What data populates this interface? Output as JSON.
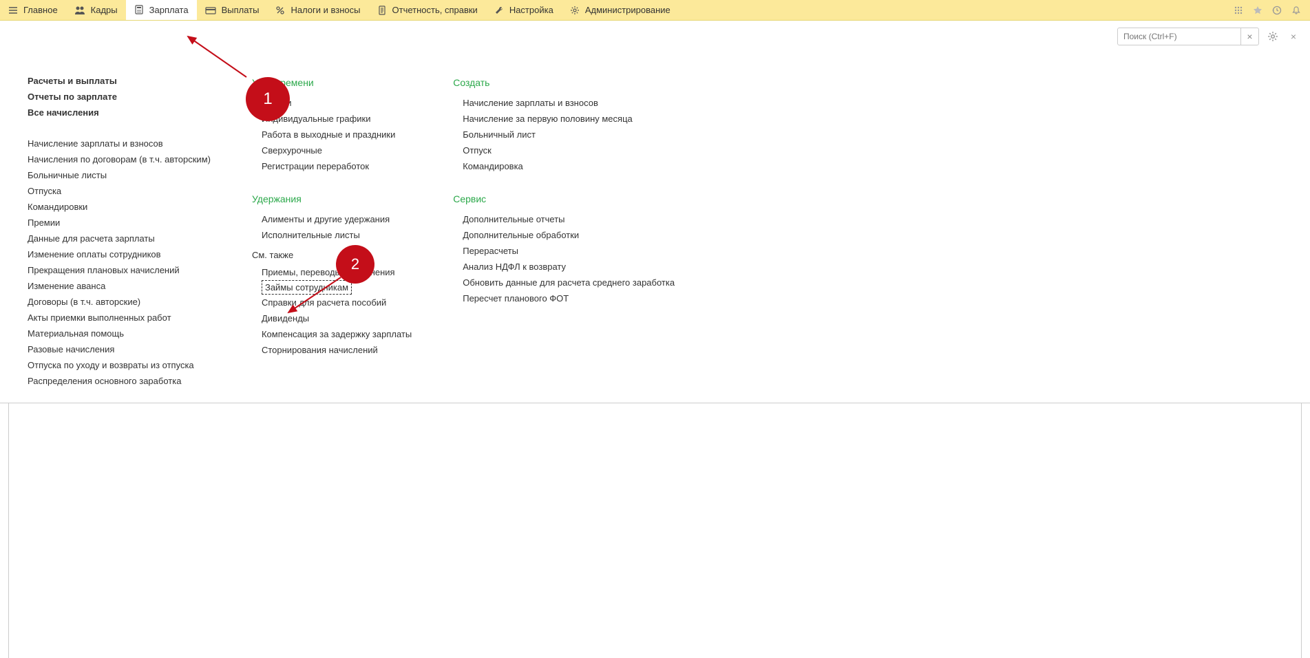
{
  "topbar": {
    "items": [
      {
        "label": "Главное",
        "icon": "menu"
      },
      {
        "label": "Кадры",
        "icon": "people"
      },
      {
        "label": "Зарплата",
        "icon": "calc",
        "active": true
      },
      {
        "label": "Выплаты",
        "icon": "card"
      },
      {
        "label": "Налоги и взносы",
        "icon": "percent"
      },
      {
        "label": "Отчетность, справки",
        "icon": "doc"
      },
      {
        "label": "Настройка",
        "icon": "wrench"
      },
      {
        "label": "Администрирование",
        "icon": "gear"
      }
    ]
  },
  "search": {
    "placeholder": "Поиск (Ctrl+F)"
  },
  "col1": {
    "bold": [
      "Расчеты и выплаты",
      "Отчеты по зарплате",
      "Все начисления"
    ],
    "links": [
      "Начисление зарплаты и взносов",
      "Начисления по договорам (в т.ч. авторским)",
      "Больничные листы",
      "Отпуска",
      "Командировки",
      "Премии",
      "Данные для расчета зарплаты",
      "Изменение оплаты сотрудников",
      "Прекращения плановых начислений",
      "Изменение аванса",
      "Договоры (в т.ч. авторские)",
      "Акты приемки выполненных работ",
      "Материальная помощь",
      "Разовые начисления",
      "Отпуска по уходу и возвраты из отпуска",
      "Распределения основного заработка"
    ]
  },
  "col2": {
    "sec1": {
      "header": "Учет времени",
      "links": [
        "Табели",
        "Индивидуальные графики",
        "Работа в выходные и праздники",
        "Сверхурочные",
        "Регистрации переработок"
      ]
    },
    "sec2": {
      "header": "Удержания",
      "links": [
        "Алименты и другие удержания",
        "Исполнительные листы"
      ]
    },
    "sec3": {
      "header": "См. также",
      "links": [
        "Приемы, переводы, увольнения",
        "Займы сотрудникам",
        "Справки для расчета пособий",
        "Дивиденды",
        "Компенсация за задержку зарплаты",
        "Сторнирования начислений"
      ]
    }
  },
  "col3": {
    "sec1": {
      "header": "Создать",
      "links": [
        "Начисление зарплаты и взносов",
        "Начисление за первую половину месяца",
        "Больничный лист",
        "Отпуск",
        "Командировка"
      ]
    },
    "sec2": {
      "header": "Сервис",
      "links": [
        "Дополнительные отчеты",
        "Дополнительные обработки",
        "Перерасчеты",
        "Анализ НДФЛ к возврату",
        "Обновить данные для расчета среднего заработка",
        "Пересчет планового ФОТ"
      ]
    }
  },
  "markers": {
    "one": "1",
    "two": "2"
  }
}
